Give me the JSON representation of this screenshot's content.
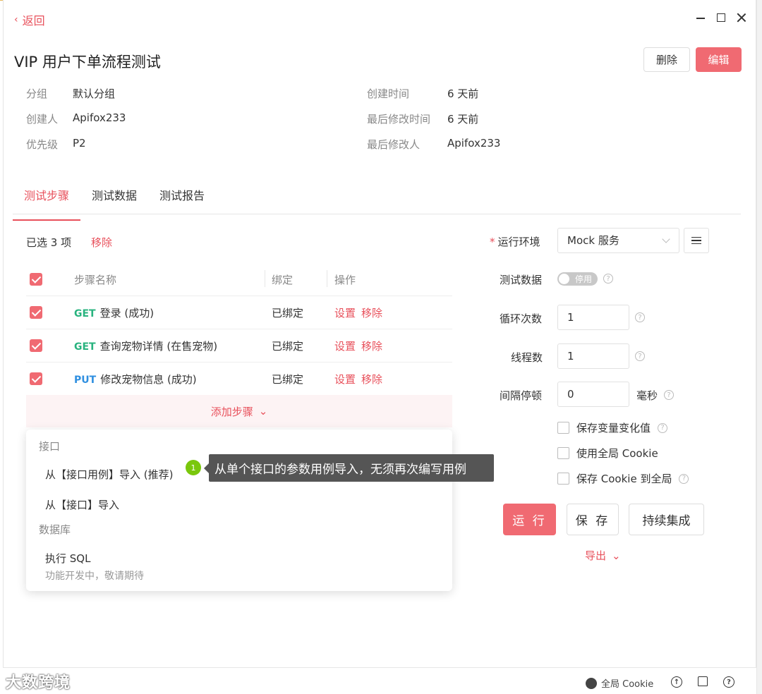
{
  "nav": {
    "back_label": "返回"
  },
  "header": {
    "title": "VIP 用户下单流程测试",
    "delete_label": "删除",
    "edit_label": "编辑"
  },
  "meta": {
    "group_label": "分组",
    "group_value": "默认分组",
    "creator_label": "创建人",
    "creator_value": "Apifox233",
    "priority_label": "优先级",
    "priority_value": "P2",
    "created_label": "创建时间",
    "created_value": "6 天前",
    "modified_label": "最后修改时间",
    "modified_value": "6 天前",
    "modifier_label": "最后修改人",
    "modifier_value": "Apifox233"
  },
  "tabs": [
    {
      "label": "测试步骤"
    },
    {
      "label": "测试数据"
    },
    {
      "label": "测试报告"
    }
  ],
  "steps": {
    "selected_text": "已选 3 项",
    "remove_label": "移除",
    "columns": {
      "name": "步骤名称",
      "bind": "绑定",
      "action": "操作"
    },
    "rows": [
      {
        "method": "GET",
        "name": "登录 (成功)",
        "bind": "已绑定",
        "set": "设置",
        "remove": "移除"
      },
      {
        "method": "GET",
        "name": "查询宠物详情 (在售宠物)",
        "bind": "已绑定",
        "set": "设置",
        "remove": "移除"
      },
      {
        "method": "PUT",
        "name": "修改宠物信息 (成功)",
        "bind": "已绑定",
        "set": "设置",
        "remove": "移除"
      }
    ],
    "add_label": "添加步骤"
  },
  "dropdown": {
    "group_api": "接口",
    "item_case": "从【接口用例】导入 (推荐)",
    "badge": "1",
    "item_api": "从【接口】导入",
    "group_db": "数据库",
    "item_sql": "执行 SQL",
    "item_sql_sub": "功能开发中，敬请期待"
  },
  "tooltip": {
    "text": "从单个接口的参数用例导入，无须再次编写用例"
  },
  "settings": {
    "env_label": "运行环境",
    "env_value": "Mock 服务",
    "data_label": "测试数据",
    "toggle_label": "停用",
    "loop_label": "循环次数",
    "loop_value": "1",
    "thread_label": "线程数",
    "thread_value": "1",
    "interval_label": "间隔停顿",
    "interval_value": "0",
    "interval_unit": "毫秒",
    "check_save_var": "保存变量变化值",
    "check_global_cookie": "使用全局 Cookie",
    "check_save_cookie": "保存 Cookie 到全局",
    "run_label": "运 行",
    "save_label": "保 存",
    "ci_label": "持续集成",
    "export_label": "导出"
  },
  "status_bar": {
    "cookie_label": "全局 Cookie",
    "watermark": "大数跨境"
  }
}
